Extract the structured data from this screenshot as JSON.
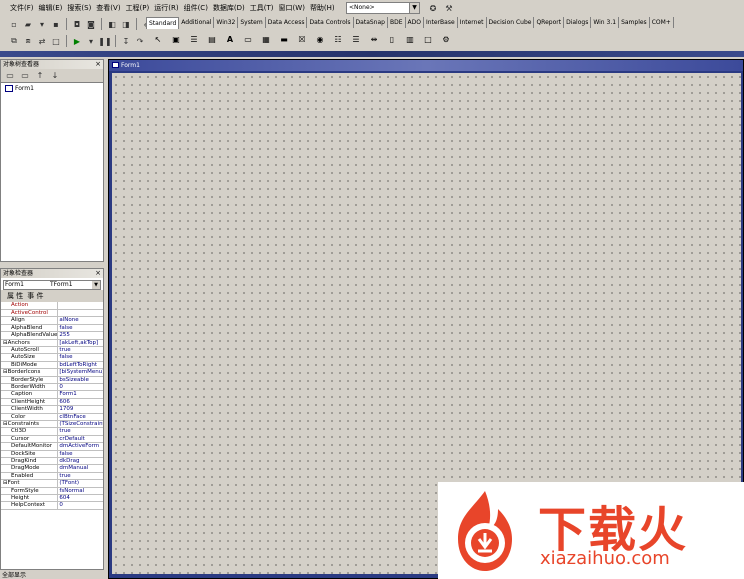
{
  "menu": [
    "文件(F)",
    "编辑(E)",
    "搜索(S)",
    "查看(V)",
    "工程(P)",
    "运行(R)",
    "组件(C)",
    "数据库(D)",
    "工具(T)",
    "窗口(W)",
    "帮助(H)"
  ],
  "desktop_combo": "<None>",
  "palette_tabs": [
    "Standard",
    "Additional",
    "Win32",
    "System",
    "Data Access",
    "Data Controls",
    "DataSnap",
    "BDE",
    "ADO",
    "InterBase",
    "Internet",
    "Decision Cube",
    "QReport",
    "Dialogs",
    "Win 3.1",
    "Samples",
    "COM+"
  ],
  "tree_panel": {
    "title": "对象树查看器",
    "item": "Form1"
  },
  "inspector": {
    "title": "对象检查器",
    "object": "Form1",
    "object_type": "TForm1",
    "tab_props": "属 性",
    "tab_events": "事 件",
    "properties": [
      {
        "name": "Action",
        "value": "",
        "red": true
      },
      {
        "name": "ActiveControl",
        "value": "",
        "red": true
      },
      {
        "name": "Align",
        "value": "alNone"
      },
      {
        "name": "AlphaBlend",
        "value": "false"
      },
      {
        "name": "AlphaBlendValue",
        "value": "255"
      },
      {
        "name": "⊟Anchors",
        "value": "[akLeft,akTop]",
        "group": true
      },
      {
        "name": "AutoScroll",
        "value": "true"
      },
      {
        "name": "AutoSize",
        "value": "false"
      },
      {
        "name": "BiDiMode",
        "value": "bdLeftToRight"
      },
      {
        "name": "⊟BorderIcons",
        "value": "[biSystemMenu]",
        "group": true
      },
      {
        "name": "BorderStyle",
        "value": "bsSizeable"
      },
      {
        "name": "BorderWidth",
        "value": "0"
      },
      {
        "name": "Caption",
        "value": "Form1",
        "selected": true
      },
      {
        "name": "ClientHeight",
        "value": "606"
      },
      {
        "name": "ClientWidth",
        "value": "1709"
      },
      {
        "name": "Color",
        "value": "clBtnFace"
      },
      {
        "name": "⊟Constraints",
        "value": "(TSizeConstraints)",
        "group": true
      },
      {
        "name": "Ctl3D",
        "value": "true"
      },
      {
        "name": "Cursor",
        "value": "crDefault"
      },
      {
        "name": "DefaultMonitor",
        "value": "dmActiveForm"
      },
      {
        "name": "DockSite",
        "value": "false"
      },
      {
        "name": "DragKind",
        "value": "dkDrag"
      },
      {
        "name": "DragMode",
        "value": "dmManual"
      },
      {
        "name": "Enabled",
        "value": "true"
      },
      {
        "name": "⊟Font",
        "value": "(TFont)",
        "group": true
      },
      {
        "name": "FormStyle",
        "value": "fsNormal"
      },
      {
        "name": "Height",
        "value": "604"
      },
      {
        "name": "HelpContext",
        "value": "0"
      }
    ]
  },
  "status_text": "全部显示",
  "designer": {
    "caption": "Form1"
  },
  "watermark": {
    "brand": "下载火",
    "url": "xiazaihuo.com"
  }
}
